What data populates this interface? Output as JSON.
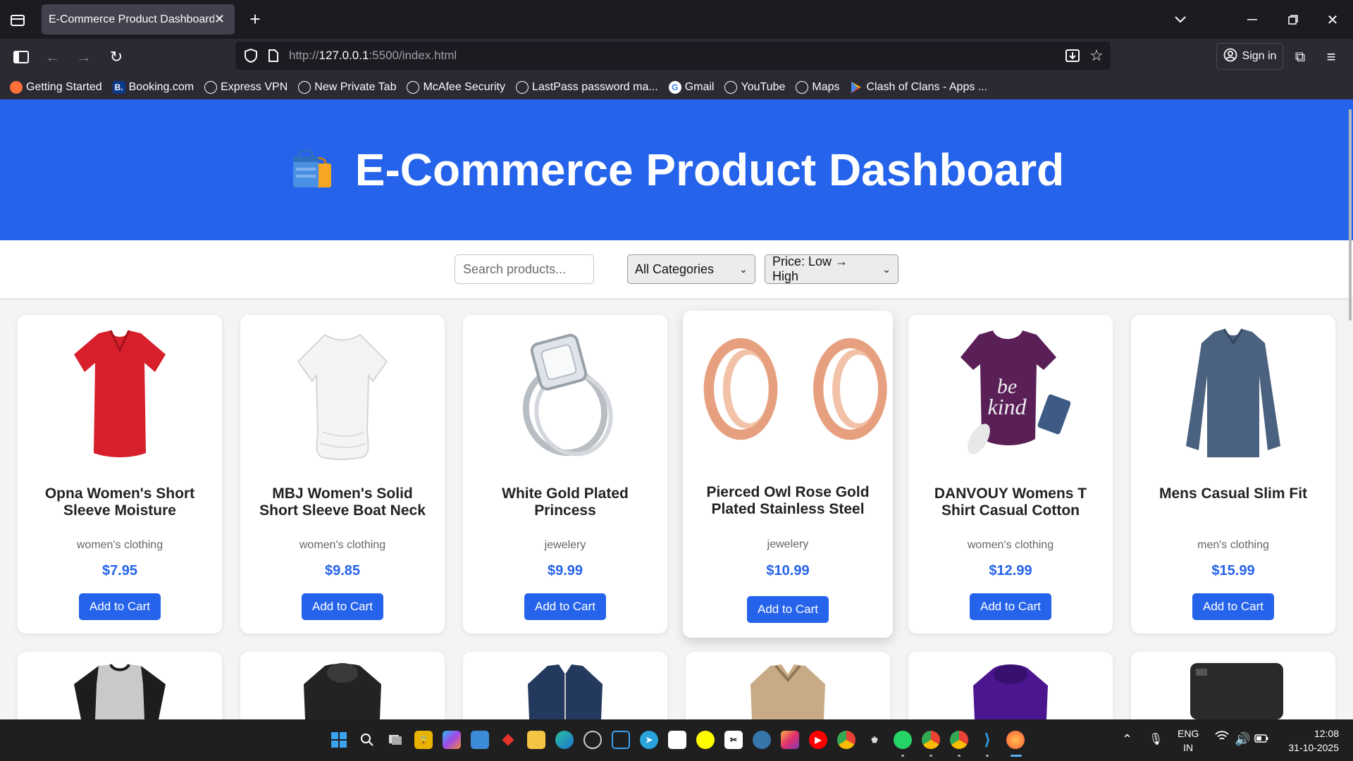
{
  "browser": {
    "tab_title": "E-Commerce Product Dashboard",
    "url_prefix": "http://",
    "url_host": "127.0.0.1",
    "url_rest": ":5500/index.html",
    "sign_in": "Sign in",
    "bookmarks": [
      {
        "label": "Getting Started",
        "icon": "firefox-icon"
      },
      {
        "label": "Booking.com",
        "icon": "booking-icon"
      },
      {
        "label": "Express VPN",
        "icon": "globe-icon"
      },
      {
        "label": "New Private Tab",
        "icon": "globe-icon"
      },
      {
        "label": "McAfee Security",
        "icon": "globe-icon"
      },
      {
        "label": "LastPass password ma...",
        "icon": "globe-icon"
      },
      {
        "label": "Gmail",
        "icon": "google-icon"
      },
      {
        "label": "YouTube",
        "icon": "globe-icon"
      },
      {
        "label": "Maps",
        "icon": "globe-icon"
      },
      {
        "label": "Clash of Clans - Apps ...",
        "icon": "google-play-icon"
      }
    ]
  },
  "header": {
    "title": "E-Commerce Product Dashboard",
    "icon": "shopping-bags-icon",
    "bg_color": "#2563eb"
  },
  "controls": {
    "search_placeholder": "Search products...",
    "category_selected": "All Categories",
    "sort_selected": "Price: Low → High"
  },
  "products": [
    {
      "title": "Opna Women's Short Sleeve Moisture",
      "category": "women's clothing",
      "price": "$7.95",
      "button": "Add to Cart",
      "image": "red-tshirt-image"
    },
    {
      "title": "MBJ Women's Solid Short Sleeve Boat Neck V",
      "category": "women's clothing",
      "price": "$9.85",
      "button": "Add to Cart",
      "image": "white-top-image"
    },
    {
      "title": "White Gold Plated Princess",
      "category": "jewelery",
      "price": "$9.99",
      "button": "Add to Cart",
      "image": "diamond-ring-image"
    },
    {
      "title": "Pierced Owl Rose Gold Plated Stainless Steel Double",
      "category": "jewelery",
      "price": "$10.99",
      "button": "Add to Cart",
      "image": "rose-gold-tunnels-image"
    },
    {
      "title": "DANVOUY Womens T Shirt Casual Cotton Short",
      "category": "women's clothing",
      "price": "$12.99",
      "button": "Add to Cart",
      "image": "purple-tshirt-image"
    },
    {
      "title": "Mens Casual Slim Fit",
      "category": "men's clothing",
      "price": "$15.99",
      "button": "Add to Cart",
      "image": "blue-longsleeve-image"
    }
  ],
  "products_row2_images": [
    "raglan-henley-image",
    "leather-jacket-image",
    "blue-jacket-image",
    "khaki-jacket-image",
    "purple-jacket-image",
    "external-hdd-image"
  ],
  "taskbar": {
    "lang_top": "ENG",
    "lang_bottom": "IN",
    "time": "12:08",
    "date": "31-10-2025"
  }
}
